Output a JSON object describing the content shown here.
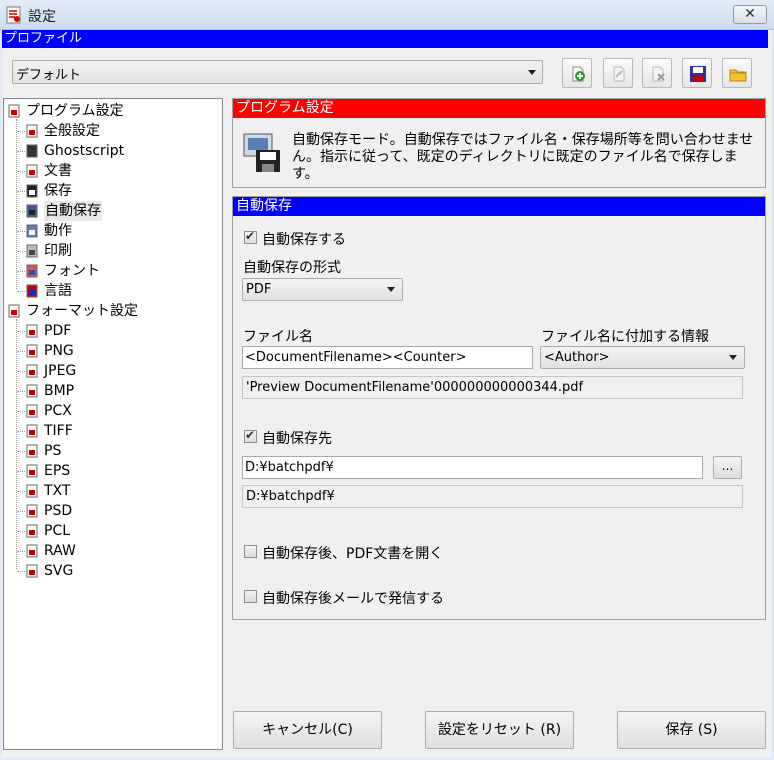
{
  "window": {
    "title": "設定",
    "close_symbol": "✕"
  },
  "profile": {
    "header": "プロファイル",
    "selected": "デフォルト",
    "toolbar_icons": [
      "add-profile-icon",
      "rename-profile-icon",
      "delete-profile-icon",
      "save-profile-icon",
      "open-folder-icon"
    ]
  },
  "tree": {
    "program_settings": {
      "label": "プログラム設定",
      "items": [
        {
          "label": "全般設定",
          "icon": "general-icon"
        },
        {
          "label": "Ghostscript",
          "icon": "ghostscript-icon"
        },
        {
          "label": "文書",
          "icon": "document-icon"
        },
        {
          "label": "保存",
          "icon": "save-icon"
        },
        {
          "label": "自動保存",
          "icon": "autosave-icon"
        },
        {
          "label": "動作",
          "icon": "action-icon"
        },
        {
          "label": "印刷",
          "icon": "print-icon"
        },
        {
          "label": "フォント",
          "icon": "font-icon"
        },
        {
          "label": "言語",
          "icon": "language-icon"
        }
      ]
    },
    "format_settings": {
      "label": "フォーマット設定",
      "items": [
        {
          "label": "PDF"
        },
        {
          "label": "PNG"
        },
        {
          "label": "JPEG"
        },
        {
          "label": "BMP"
        },
        {
          "label": "PCX"
        },
        {
          "label": "TIFF"
        },
        {
          "label": "PS"
        },
        {
          "label": "EPS"
        },
        {
          "label": "TXT"
        },
        {
          "label": "PSD"
        },
        {
          "label": "PCL"
        },
        {
          "label": "RAW"
        },
        {
          "label": "SVG"
        }
      ]
    },
    "selected": "自動保存"
  },
  "program_section": {
    "header": "プログラム設定",
    "description": "自動保存モード。自動保存ではファイル名・保存場所等を問い合わせません。指示に従って、既定のディレクトリに既定のファイル名で保存します。"
  },
  "autosave": {
    "header": "自動保存",
    "enable_label": "自動保存する",
    "enable_checked": true,
    "format_label": "自動保存の形式",
    "format_value": "PDF",
    "filename_label": "ファイル名",
    "filename_value": "<DocumentFilename><Counter>",
    "token_label": "ファイル名に付加する情報",
    "token_value": "<Author>",
    "filename_preview": "'Preview DocumentFilename'000000000000344.pdf",
    "destination_label": "自動保存先",
    "destination_checked": true,
    "destination_value": "D:¥batchpdf¥",
    "browse_label": "...",
    "destination_preview": "D:¥batchpdf¥",
    "open_after_label": "自動保存後、PDF文書を開く",
    "open_after_checked": false,
    "mail_after_label": "自動保存後メールで発信する",
    "mail_after_checked": false
  },
  "buttons": {
    "cancel": "キャンセル(C)",
    "reset": "設定をリセット (R)",
    "save": "保存 (S)"
  }
}
